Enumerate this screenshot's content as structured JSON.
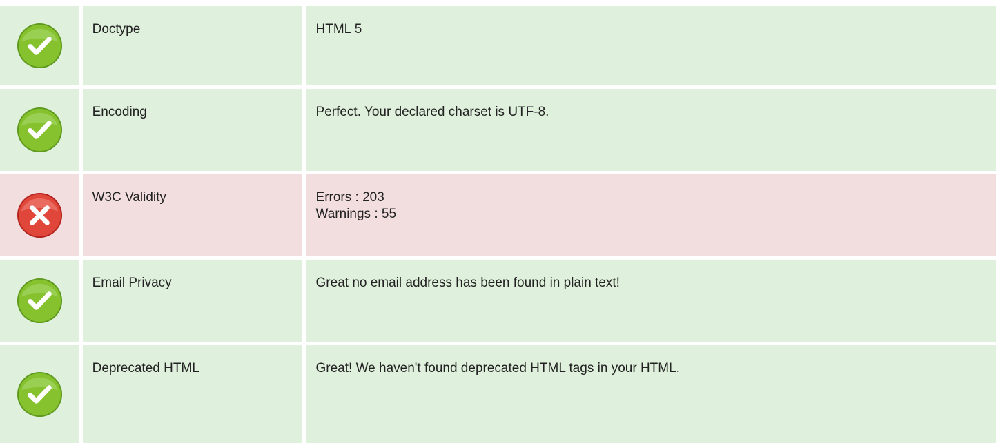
{
  "colors": {
    "ok_background": "#dff0dc",
    "error_background": "#f2dddf",
    "ok_icon": "#7ab82a",
    "error_icon": "#d93832"
  },
  "rows": [
    {
      "status": "pass",
      "icon": "check-circle-icon",
      "name": "Doctype",
      "value_lines": [
        "HTML 5"
      ]
    },
    {
      "status": "pass",
      "icon": "check-circle-icon",
      "name": "Encoding",
      "value_lines": [
        "Perfect. Your declared charset is UTF-8."
      ]
    },
    {
      "status": "fail",
      "icon": "x-circle-icon",
      "name": "W3C Validity",
      "value_lines": [
        "Errors : 203",
        "Warnings : 55"
      ]
    },
    {
      "status": "pass",
      "icon": "check-circle-icon",
      "name": "Email Privacy",
      "value_lines": [
        "Great no email address has been found in plain text!"
      ]
    },
    {
      "status": "pass",
      "icon": "check-circle-icon",
      "name": "Deprecated HTML",
      "value_lines": [
        "Great! We haven't found deprecated HTML tags in your HTML."
      ]
    }
  ]
}
